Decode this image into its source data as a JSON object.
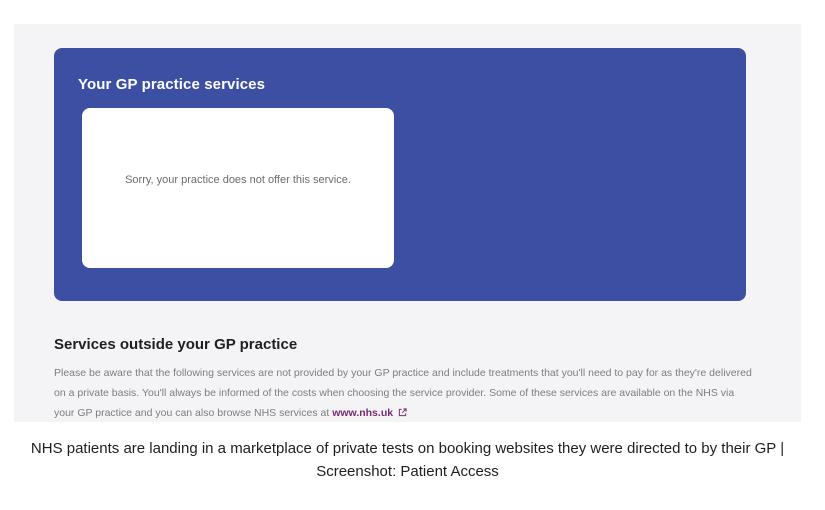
{
  "gp_panel": {
    "title": "Your GP practice services",
    "message": "Sorry, your practice does not offer this service."
  },
  "outside": {
    "heading": "Services outside your GP practice",
    "body": "Please be aware that the following services are not provided by your GP practice and include treatments that you'll need to pay for as they're delivered on a private basis. You'll always be informed of the costs when choosing the service provider. Some of these services are available on the NHS via your GP practice and you can also browse NHS services at",
    "link_text": "www.nhs.uk",
    "link_icon": "external-link-icon"
  },
  "caption": {
    "text": "NHS patients are landing in a marketplace of private tests on booking websites they were directed to by their GP | Screenshot: Patient Access"
  },
  "colors": {
    "panel": "#3d4fa3",
    "link": "#7a2c6e",
    "page_bg": "#f4f4f6"
  }
}
